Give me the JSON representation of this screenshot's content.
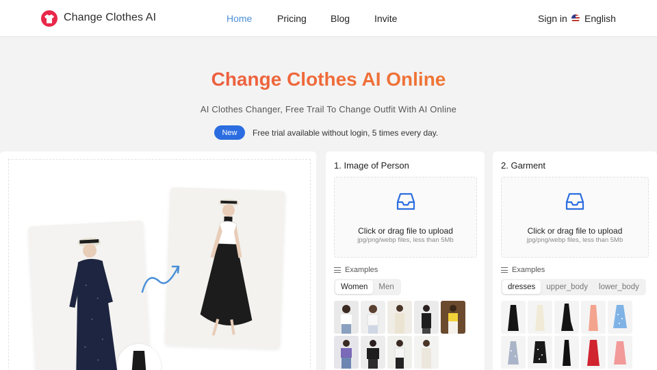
{
  "header": {
    "brand": "Change Clothes AI",
    "nav": [
      "Home",
      "Pricing",
      "Blog",
      "Invite"
    ],
    "active_nav": "Home",
    "sign_in": "Sign in",
    "language": "English",
    "icons": [
      "tshirt-logo-icon",
      "us-flag-icon"
    ]
  },
  "hero": {
    "title": "Change Clothes AI Online",
    "subtitle": "AI Clothes Changer, Free Trail To Change Outfit With AI Online",
    "badge": "New",
    "notice": "Free trial available without login, 5 times every day."
  },
  "person_card": {
    "title": "1. Image of Person",
    "upload_text": "Click or drag file to upload",
    "upload_hint": "jpg/png/webp files, less than 5Mb",
    "examples_label": "Examples",
    "tabs": [
      "Women",
      "Men"
    ],
    "active_tab": "Women"
  },
  "garment_card": {
    "title": "2. Garment",
    "upload_text": "Click or drag file to upload",
    "upload_hint": "jpg/png/webp files, less than 5Mb",
    "examples_label": "Examples",
    "tabs": [
      "dresses",
      "upper_body",
      "lower_body"
    ],
    "active_tab": "dresses"
  },
  "colors": {
    "accent_blue": "#2b6de0",
    "nav_active": "#4a8fd8",
    "title_gradient_start": "#e8484a",
    "title_gradient_end": "#f08a2c",
    "logo": "#e8284a"
  }
}
